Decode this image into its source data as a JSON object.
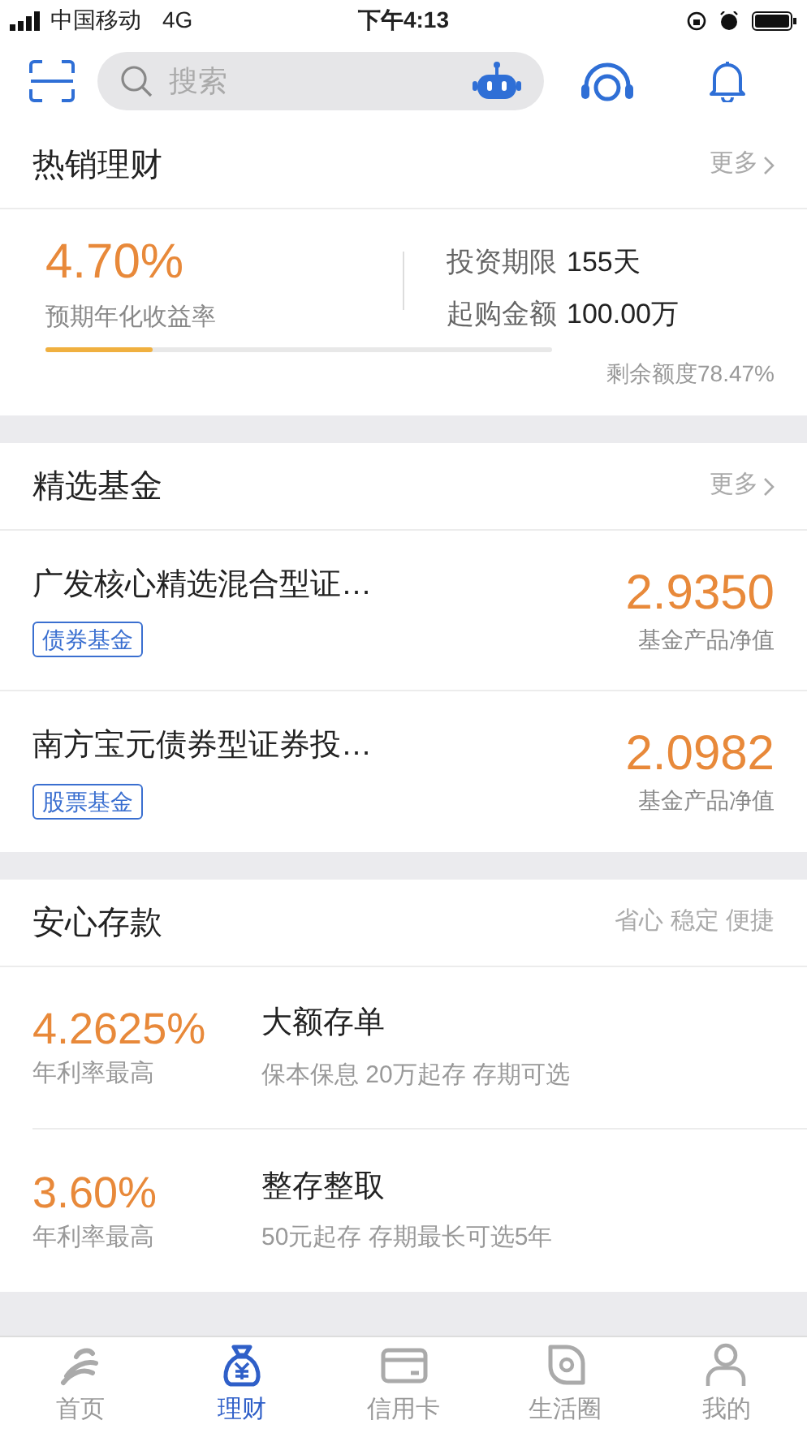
{
  "status_bar": {
    "carrier": "中国移动",
    "network": "4G",
    "time": "下午4:13"
  },
  "search": {
    "placeholder": "搜索"
  },
  "hot": {
    "title": "热销理财",
    "more": "更多",
    "rate": "4.70%",
    "rate_label": "预期年化收益率",
    "term_label": "投资期限",
    "term": "155天",
    "min_label": "起购金额",
    "min": "100.00万",
    "level": 0.21,
    "remaining": "剩余额度78.47%"
  },
  "funds": {
    "title": "精选基金",
    "more": "更多",
    "items": [
      {
        "name": "广发核心精选混合型证…",
        "tag": "债券基金",
        "value": "2.9350",
        "value_label": "基金产品净值"
      },
      {
        "name": "南方宝元债券型证券投…",
        "tag": "股票基金",
        "value": "2.0982",
        "value_label": "基金产品净值"
      }
    ]
  },
  "deposits": {
    "title": "安心存款",
    "slogan": "省心 稳定 便捷",
    "items": [
      {
        "rate": "4.2625%",
        "rate_label": "年利率最高",
        "name": "大额存单",
        "desc": "保本保息 20万起存 存期可选"
      },
      {
        "rate": "3.60%",
        "rate_label": "年利率最高",
        "name": "整存整取",
        "desc": "50元起存 存期最长可选5年"
      }
    ]
  },
  "tabs": [
    {
      "kind": "home",
      "label": "首页",
      "selected": false
    },
    {
      "kind": "bag",
      "label": "理财",
      "selected": true
    },
    {
      "kind": "card",
      "label": "信用卡",
      "selected": false
    },
    {
      "kind": "life",
      "label": "生活圈",
      "selected": false
    },
    {
      "kind": "user",
      "label": "我的",
      "selected": false
    }
  ]
}
